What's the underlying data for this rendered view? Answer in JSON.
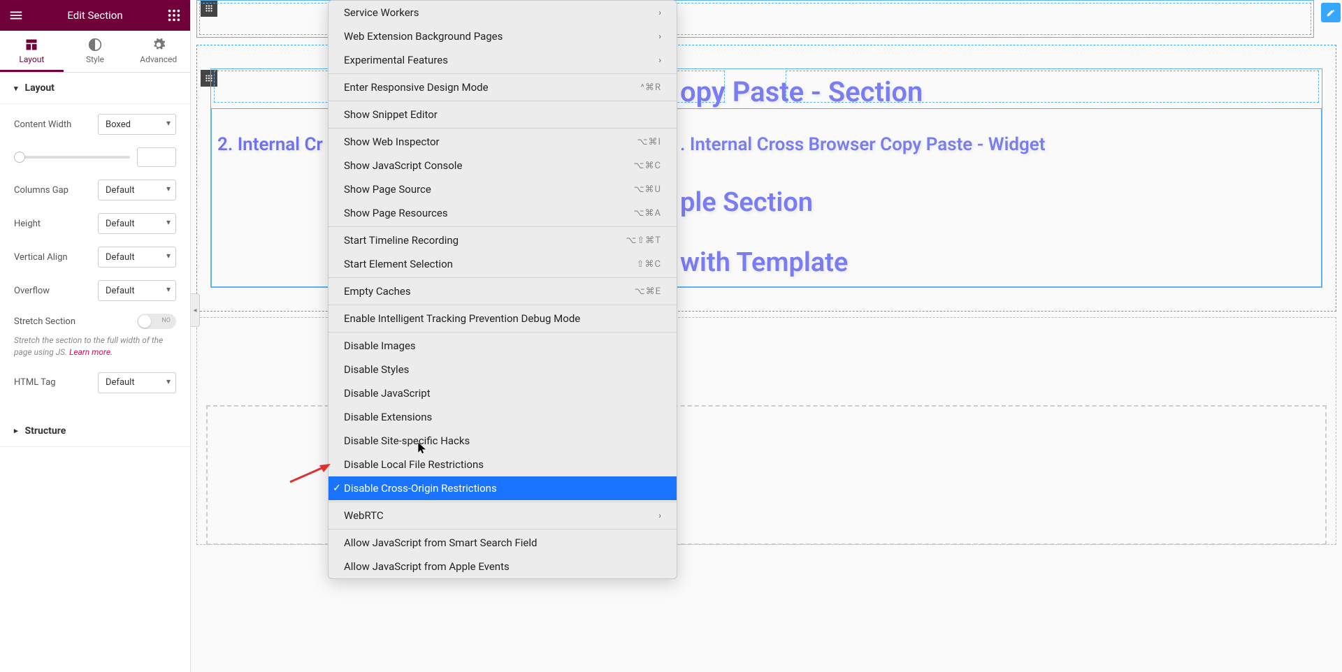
{
  "header": {
    "title": "Edit Section"
  },
  "tabs": [
    {
      "id": "layout",
      "label": "Layout",
      "active": true
    },
    {
      "id": "style",
      "label": "Style",
      "active": false
    },
    {
      "id": "advanced",
      "label": "Advanced",
      "active": false
    }
  ],
  "panel": {
    "section_title": "Layout",
    "content_width_label": "Content Width",
    "content_width_value": "Boxed",
    "slider_value": "",
    "columns_gap_label": "Columns Gap",
    "columns_gap_value": "Default",
    "height_label": "Height",
    "height_value": "Default",
    "vertical_align_label": "Vertical Align",
    "vertical_align_value": "Default",
    "overflow_label": "Overflow",
    "overflow_value": "Default",
    "stretch_label": "Stretch Section",
    "stretch_toggle_off": "NO",
    "stretch_hint_a": "Stretch the section to the full width of the page using JS. ",
    "stretch_hint_link": "Learn more.",
    "html_tag_label": "HTML Tag",
    "html_tag_value": "Default",
    "structure_title": "Structure"
  },
  "canvas": {
    "heading_section": "opy Paste - Section",
    "heading_widget_left": "2. Internal Cr",
    "heading_widget_right": ". Internal Cross Browser Copy Paste - Widget",
    "heading_simple": "ple Section",
    "heading_template": " with Template"
  },
  "context_menu": {
    "groups": [
      [
        {
          "label": "Service Workers",
          "submenu": true
        },
        {
          "label": "Web Extension Background Pages",
          "submenu": true
        },
        {
          "label": "Experimental Features",
          "submenu": true
        }
      ],
      [
        {
          "label": "Enter Responsive Design Mode",
          "shortcut": "^⌘R"
        }
      ],
      [
        {
          "label": "Show Snippet Editor"
        }
      ],
      [
        {
          "label": "Show Web Inspector",
          "shortcut": "⌥⌘I"
        },
        {
          "label": "Show JavaScript Console",
          "shortcut": "⌥⌘C"
        },
        {
          "label": "Show Page Source",
          "shortcut": "⌥⌘U"
        },
        {
          "label": "Show Page Resources",
          "shortcut": "⌥⌘A"
        }
      ],
      [
        {
          "label": "Start Timeline Recording",
          "shortcut": "⌥⇧⌘T"
        },
        {
          "label": "Start Element Selection",
          "shortcut": "⇧⌘C"
        }
      ],
      [
        {
          "label": "Empty Caches",
          "shortcut": "⌥⌘E"
        }
      ],
      [
        {
          "label": "Enable Intelligent Tracking Prevention Debug Mode"
        }
      ],
      [
        {
          "label": "Disable Images"
        },
        {
          "label": "Disable Styles"
        },
        {
          "label": "Disable JavaScript"
        },
        {
          "label": "Disable Extensions"
        },
        {
          "label": "Disable Site-specific Hacks"
        },
        {
          "label": "Disable Local File Restrictions"
        },
        {
          "label": "Disable Cross-Origin Restrictions",
          "checked": true,
          "selected": true
        }
      ],
      [
        {
          "label": "WebRTC",
          "submenu": true
        }
      ],
      [
        {
          "label": "Allow JavaScript from Smart Search Field"
        },
        {
          "label": "Allow JavaScript from Apple Events"
        }
      ]
    ]
  }
}
